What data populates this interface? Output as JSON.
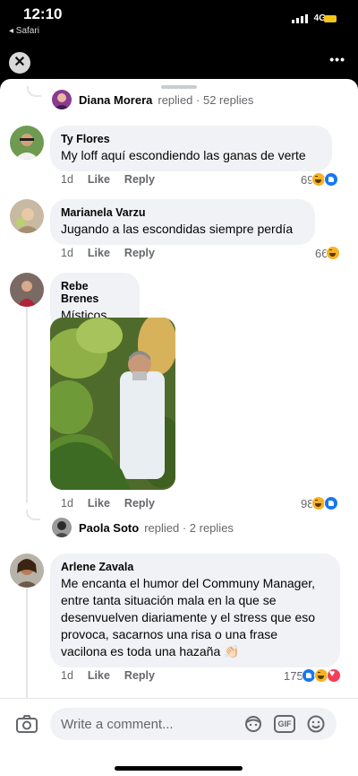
{
  "status_bar": {
    "time": "12:10",
    "back_label": "◂ Safari",
    "network": "4G"
  },
  "top_bar": {
    "close_glyph": "✕",
    "more_glyph": "•••"
  },
  "thread": {
    "top_reply": {
      "name": "Diana Morera",
      "verb": "replied",
      "count": "· 52 replies"
    },
    "comments": [
      {
        "author": "Ty Flores",
        "text": "My loff aquí escondiendo las ganas de verte",
        "age": "1d",
        "like": "Like",
        "reply": "Reply",
        "count": "69",
        "reactions": [
          "haha",
          "like"
        ]
      },
      {
        "author": "Marianela Varzu",
        "text": "Jugando a las escondidas siempre perdía",
        "age": "1d",
        "like": "Like",
        "reply": "Reply",
        "count": "66",
        "reactions": [
          "haha"
        ]
      },
      {
        "author": "Rebe Brenes",
        "text": "Místicos",
        "age": "1d",
        "like": "Like",
        "reply": "Reply",
        "count": "98",
        "reactions": [
          "haha",
          "like"
        ],
        "replies": {
          "name": "Paola Soto",
          "verb": "replied",
          "count": "· 2 replies"
        }
      },
      {
        "author": "Arlene Zavala",
        "lines": [
          "Me encanta el humor del Communy Manager,",
          "entre tanta situación mala en la que se",
          "desenvuelven diariamente y el stress que eso",
          "provoca, sacarnos una risa o una frase",
          "vacilona es toda una hazaña 👏🏻"
        ],
        "age": "1d",
        "like": "Like",
        "reply": "Reply",
        "count": "175",
        "reactions": [
          "like",
          "haha",
          "love"
        ]
      }
    ]
  },
  "composer": {
    "placeholder": "Write a comment...",
    "gif_label": "GIF"
  }
}
